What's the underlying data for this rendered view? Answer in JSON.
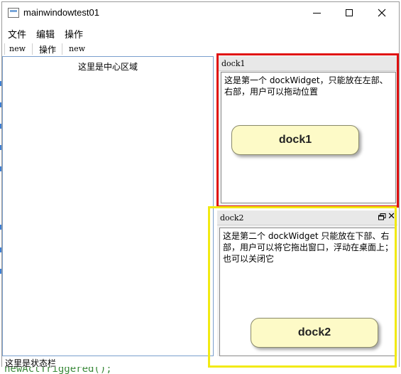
{
  "window": {
    "title": "mainwindowtest01"
  },
  "menubar": {
    "items": [
      "文件",
      "编辑",
      "操作"
    ]
  },
  "toolbar": {
    "items": [
      "new",
      "操作",
      "new"
    ]
  },
  "central": {
    "label": "这里是中心区域"
  },
  "dock1": {
    "title": "dock1",
    "text": "这是第一个 dockWidget，只能放在左部、右部，用户可以拖动位置",
    "button": "dock1"
  },
  "dock2": {
    "title": "dock2",
    "text": "这是第二个 dockWidget 只能放在下部、右部，用户可以将它拖出窗口，浮动在桌面上；也可以关闭它",
    "button": "dock2",
    "close_glyph": "✕"
  },
  "statusbar": {
    "text": "这里是状态栏"
  },
  "backdrop": {
    "bottom_code": "newActTriggered();"
  },
  "colors": {
    "red_frame": "#e01010",
    "yellow_frame": "#f2ea12",
    "bubble": "#fdfac7",
    "central_border": "#7a9fcd"
  }
}
